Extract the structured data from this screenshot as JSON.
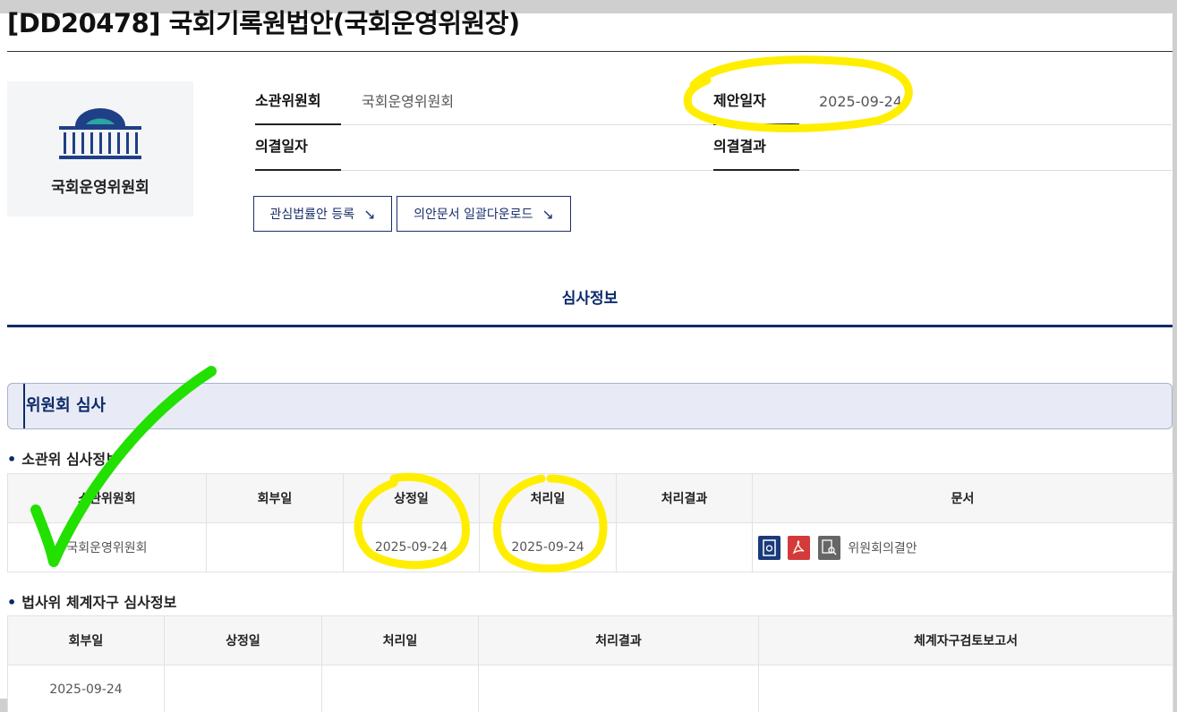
{
  "title": "[DD20478] 국회기록원법안(국회운영위원장)",
  "committee": {
    "logo_name": "국회운영위원회"
  },
  "info": {
    "jurisdiction_label": "소관위원회",
    "jurisdiction_value": "국회운영위원회",
    "proposal_date_label": "제안일자",
    "proposal_date_value": "2025-09-24",
    "resolution_date_label": "의결일자",
    "resolution_date_value": "",
    "resolution_result_label": "의결결과",
    "resolution_result_value": ""
  },
  "buttons": {
    "watch_bill": "관심법률안 등록",
    "bulk_download": "의안문서 일괄다운로드"
  },
  "tab": {
    "review_info": "심사정보"
  },
  "section": {
    "committee_review": "위원회 심사"
  },
  "jurisdiction_review": {
    "heading": "소관위 심사정보",
    "columns": [
      "소관위원회",
      "회부일",
      "상정일",
      "처리일",
      "처리결과",
      "문서"
    ],
    "row": {
      "committee": "국회운영위원회",
      "referral_date": "",
      "presentation_date": "2025-09-24",
      "processing_date": "2025-09-24",
      "processing_result": "",
      "document_label": "위원회의결안"
    }
  },
  "legislation_review": {
    "heading": "법사위 체계자구 심사정보",
    "columns": [
      "회부일",
      "상정일",
      "처리일",
      "처리결과",
      "체계자구검토보고서"
    ],
    "row": {
      "referral_date": "2025-09-24",
      "presentation_date": "",
      "processing_date": "",
      "processing_result": "",
      "report": ""
    }
  },
  "colors": {
    "navy": "#0b2a6a",
    "highlight": "#ffee00",
    "checkmark": "#22e000",
    "hwp_icon": "#1a3a7a",
    "pdf_icon": "#d33a3a",
    "view_icon": "#666666"
  },
  "icons": [
    "assembly-logo-icon",
    "arrow-down-right-icon",
    "hwp-file-icon",
    "pdf-file-icon",
    "document-view-icon"
  ]
}
